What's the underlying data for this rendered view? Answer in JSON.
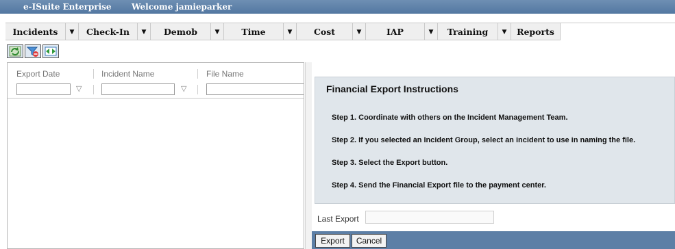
{
  "app": {
    "title": "e-ISuite Enterprise",
    "welcome": "Welcome jamieparker"
  },
  "menu": {
    "items": [
      {
        "label": "Incidents"
      },
      {
        "label": "Check-In"
      },
      {
        "label": "Demob"
      },
      {
        "label": "Time"
      },
      {
        "label": "Cost"
      },
      {
        "label": "IAP"
      },
      {
        "label": "Training"
      },
      {
        "label": "Reports"
      }
    ],
    "caret": "▼"
  },
  "toolbar": {
    "icons": [
      "refresh-icon",
      "clear-filter-icon",
      "expand-icon"
    ]
  },
  "grid": {
    "columns": [
      "Export Date",
      "Incident Name",
      "File Name"
    ],
    "filter_symbol": "▽",
    "rows": []
  },
  "instructions": {
    "title": "Financial Export Instructions",
    "steps": [
      "Step 1. Coordinate with others on the Incident Management Team.",
      "Step 2. If you selected an Incident Group, select an incident to use in naming the file.",
      "Step 3. Select the Export button.",
      "Step 4. Send the Financial Export file to the payment center."
    ]
  },
  "last_export": {
    "label": "Last Export",
    "value": ""
  },
  "actions": {
    "export_label": "Export",
    "cancel_label": "Cancel"
  },
  "colors": {
    "title_bar": "#5f83ac",
    "menu_bg": "#efefef",
    "instructions_bg": "#e0e6eb",
    "button_bar": "#5d7fa6"
  }
}
